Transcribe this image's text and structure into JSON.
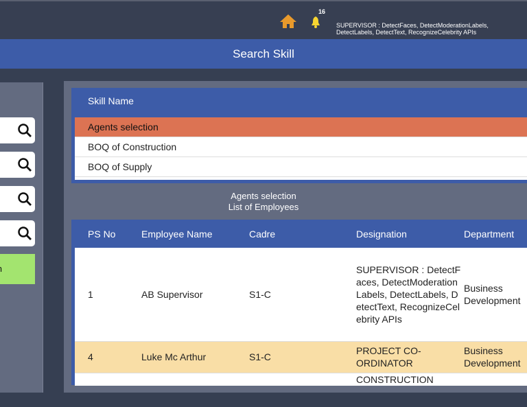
{
  "topbar": {
    "notification_count": "16",
    "roles_text": "SUPERVISOR : DetectFaces, DetectModerationLabels, DetectLabels, DetectText, RecognizeCelebrity APIs"
  },
  "header": {
    "title": "Search Skill"
  },
  "sidebar": {
    "search_count": 4,
    "button_label": "n"
  },
  "skills": {
    "column": "Skill Name",
    "items": [
      "Agents selection",
      "BOQ of Construction",
      "BOQ of Supply"
    ],
    "selected": 0
  },
  "employees": {
    "caption_line1": "Agents selection",
    "caption_line2": "List of Employees",
    "columns": [
      "PS No",
      "Employee Name",
      "Cadre",
      "Designation",
      "Department"
    ],
    "rows": [
      {
        "ps": "1",
        "name": "AB  Supervisor",
        "cadre": "S1-C",
        "designation": "SUPERVISOR : DetectFaces, DetectModerationLabels, DetectLabels, DetectText, RecognizeCelebrity APIs",
        "department": "Business Development"
      },
      {
        "ps": "4",
        "name": "Luke  Mc Arthur",
        "cadre": "S1-C",
        "designation": "PROJECT CO-ORDINATOR",
        "department": "Business Development"
      },
      {
        "ps": "",
        "name": "",
        "cadre": "",
        "designation": "CONSTRUCTION",
        "department": ""
      }
    ]
  },
  "colors": {
    "accent": "#3d5ca8",
    "selected_row": "#dc7353",
    "highlight_row": "#f9dea6",
    "button": "#a3e46f"
  }
}
